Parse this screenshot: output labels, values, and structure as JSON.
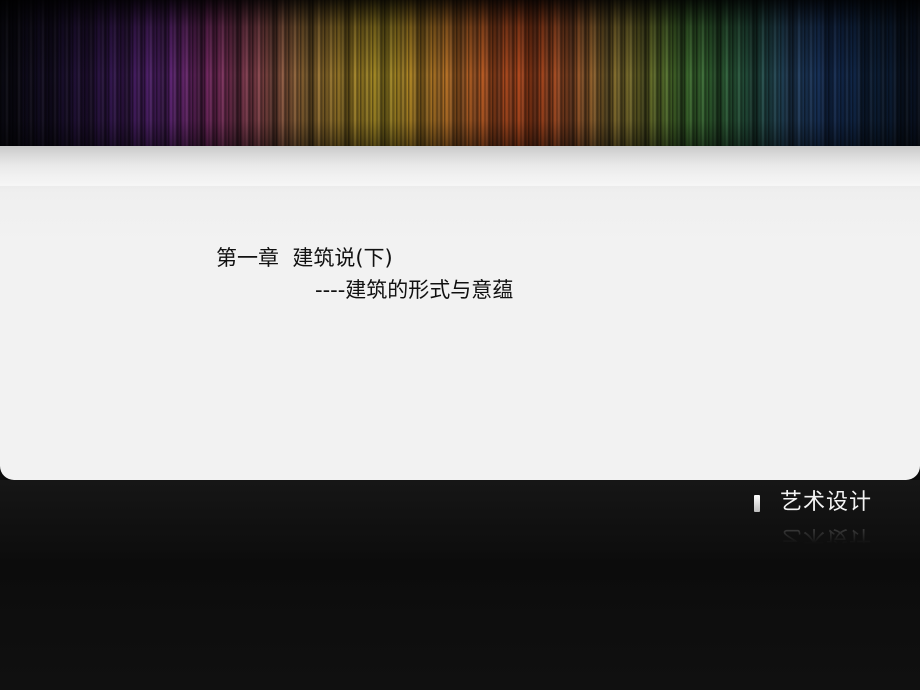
{
  "slide": {
    "title_line_1": "第一章  建筑说(下)",
    "title_line_2": "----建筑的形式与意蕴"
  },
  "brand": {
    "label": "艺术设计",
    "mark_icon": "white-bar-icon"
  },
  "colors": {
    "panel_background": "#f2f2f2",
    "footer_background": "#0e0e0e",
    "title_text": "#111111",
    "brand_text": "#f4f4f4"
  }
}
